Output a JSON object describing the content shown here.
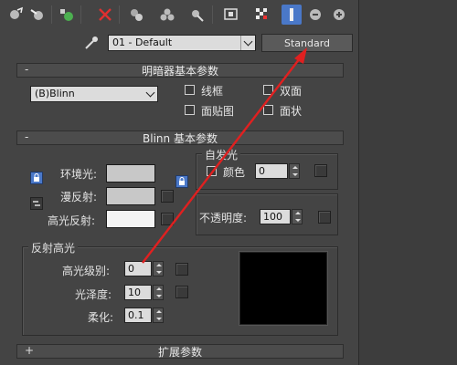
{
  "toolbar": {
    "icons": [
      "get-material-icon",
      "put-to-scene-icon",
      "assign-material-icon",
      "reset-map-icon",
      "copy-material-icon",
      "make-unique-icon",
      "put-to-library-icon",
      "material-id-icon",
      "show-map-icon",
      "show-background-icon",
      "show-end-result-icon",
      "go-to-parent-icon",
      "go-forward-icon"
    ]
  },
  "material": {
    "name": "01 - Default",
    "type_button": "Standard"
  },
  "shader_rollout": {
    "sign": "-",
    "title": "明暗器基本参数",
    "shader_value": "(B)Blinn",
    "wire": "线框",
    "two_sided": "双面",
    "face_map": "面贴图",
    "faceted": "面状"
  },
  "blinn_rollout": {
    "sign": "-",
    "title": "Blinn 基本参数",
    "self_illum_title": "自发光",
    "color_label": "颜色",
    "color_value": "0",
    "ambient": "环境光:",
    "diffuse": "漫反射:",
    "specular": "高光反射:",
    "opacity_label": "不透明度:",
    "opacity_value": "100",
    "spec_group_title": "反射高光",
    "spec_level_label": "高光级别:",
    "spec_level_value": "0",
    "gloss_label": "光泽度:",
    "gloss_value": "10",
    "soften_label": "柔化:",
    "soften_value": "0.1"
  },
  "extended_rollout": {
    "sign": "+",
    "title": "扩展参数"
  },
  "colors": {
    "accent_blue": "#4a78c8",
    "annotation_arrow": "#e02020",
    "ambient_swatch": "#c8c8c8",
    "diffuse_swatch": "#c8c8c8",
    "specular_swatch": "#f4f4f4",
    "highlight_preview": "#000000"
  }
}
